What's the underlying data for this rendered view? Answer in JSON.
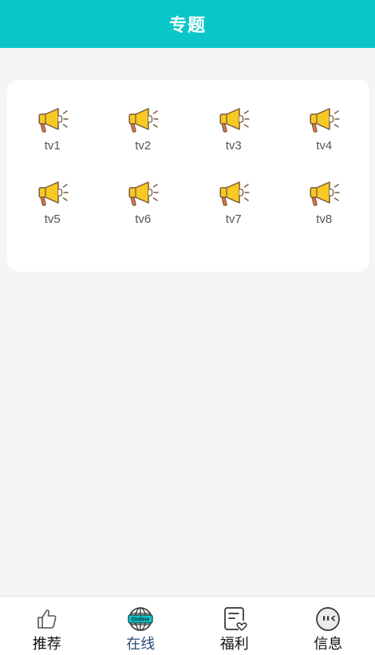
{
  "header": {
    "title": "专题"
  },
  "topics": [
    {
      "label": "tv1",
      "icon": "megaphone-icon"
    },
    {
      "label": "tv2",
      "icon": "megaphone-icon"
    },
    {
      "label": "tv3",
      "icon": "megaphone-icon"
    },
    {
      "label": "tv4",
      "icon": "megaphone-icon"
    },
    {
      "label": "tv5",
      "icon": "megaphone-icon"
    },
    {
      "label": "tv6",
      "icon": "megaphone-icon"
    },
    {
      "label": "tv7",
      "icon": "megaphone-icon"
    },
    {
      "label": "tv8",
      "icon": "megaphone-icon"
    }
  ],
  "nav": {
    "items": [
      {
        "label": "推荐",
        "icon": "thumbs-up-icon",
        "active": false
      },
      {
        "label": "在线",
        "icon": "globe-online-icon",
        "badge": "Online",
        "active": true
      },
      {
        "label": "福利",
        "icon": "notes-heart-icon",
        "active": false
      },
      {
        "label": "信息",
        "icon": "face-icon",
        "active": false
      }
    ]
  },
  "colors": {
    "accent": "#0bc6c9",
    "nav_active": "#2a4a78",
    "megaphone_yellow": "#f7c924",
    "megaphone_outline": "#7a5a3a",
    "megaphone_handle": "#e0754a"
  }
}
